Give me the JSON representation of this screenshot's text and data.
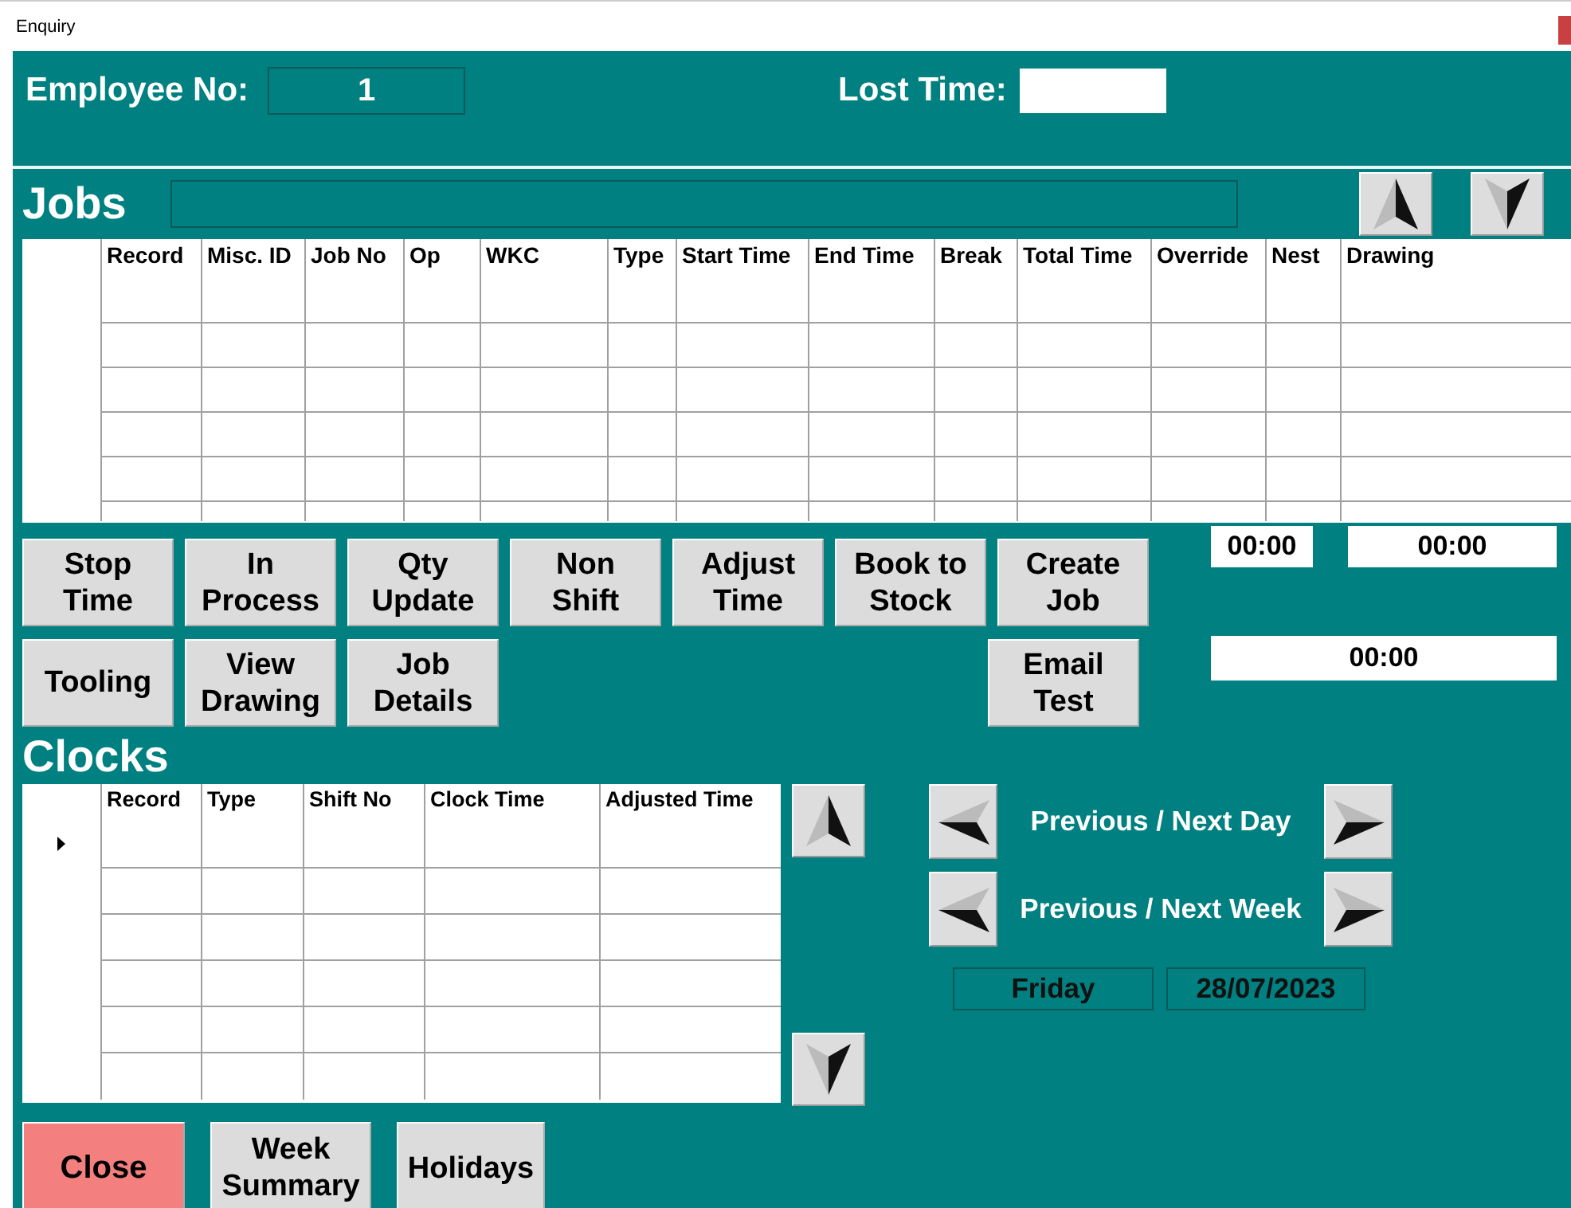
{
  "window": {
    "title": "Enquiry"
  },
  "header": {
    "employee_label": "Employee No:",
    "employee_no": "1",
    "lost_time_label": "Lost Time:"
  },
  "jobs": {
    "title": "Jobs",
    "columns": [
      "Record",
      "Misc. ID",
      "Job No",
      "Op",
      "WKC",
      "Type",
      "Start Time",
      "End Time",
      "Break",
      "Total Time",
      "Override",
      "Nest",
      "Drawing"
    ]
  },
  "job_buttons_row1": [
    {
      "lines": [
        "Stop",
        "Time"
      ]
    },
    {
      "lines": [
        "In",
        "Process"
      ]
    },
    {
      "lines": [
        "Qty",
        "Update"
      ]
    },
    {
      "lines": [
        "Non",
        "Shift"
      ]
    },
    {
      "lines": [
        "Adjust",
        "Time"
      ]
    },
    {
      "lines": [
        "Book to",
        "Stock"
      ]
    },
    {
      "lines": [
        "Create",
        "Job"
      ]
    }
  ],
  "job_buttons_row2": {
    "left": [
      {
        "lines": [
          "Tooling"
        ]
      },
      {
        "lines": [
          "View",
          "Drawing"
        ]
      },
      {
        "lines": [
          "Job",
          "Details"
        ]
      }
    ],
    "right": [
      {
        "lines": [
          "Email",
          "Test"
        ]
      }
    ]
  },
  "totals": [
    "00:00",
    "00:00",
    "00:00"
  ],
  "clocks": {
    "title": "Clocks",
    "columns": [
      "Record",
      "Type",
      "Shift No",
      "Clock Time",
      "Adjusted Time"
    ]
  },
  "navigation": {
    "day_label": "Previous / Next Day",
    "week_label": "Previous / Next Week",
    "day": "Friday",
    "date": "28/07/2023"
  },
  "bottom_buttons": [
    {
      "kind": "close",
      "lines": [
        "Close"
      ]
    },
    {
      "kind": "normal",
      "lines": [
        "Week",
        "Summary"
      ]
    },
    {
      "kind": "normal",
      "lines": [
        "Holidays"
      ]
    }
  ]
}
